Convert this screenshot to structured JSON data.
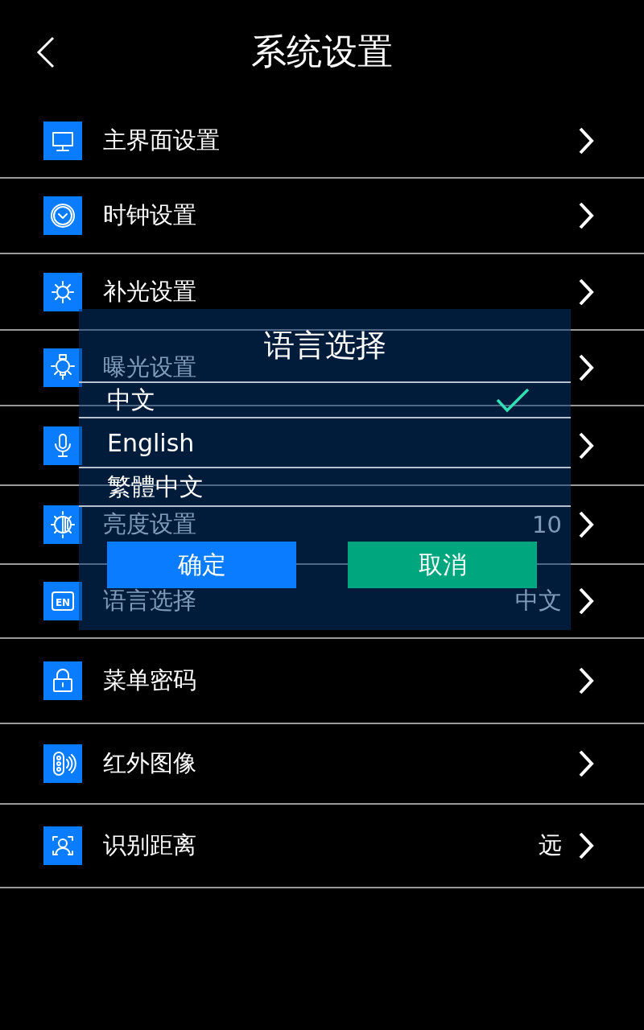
{
  "header": {
    "title": "系统设置"
  },
  "menu": [
    {
      "label": "主界面设置",
      "chevron": true
    },
    {
      "label": "时钟设置",
      "chevron": true
    },
    {
      "label": "补光设置",
      "chevron": true
    },
    {
      "label": "曝光设置",
      "chevron": true
    },
    {
      "chevron": true
    },
    {
      "label": "亮度设置",
      "value": "10",
      "chevron": true
    },
    {
      "label": "语言选择",
      "value": "中文",
      "icon_text": "EN",
      "chevron": true
    },
    {
      "label": "菜单密码",
      "chevron": true
    },
    {
      "label": "红外图像",
      "chevron": true
    },
    {
      "label": "识别距离",
      "value": "远",
      "chevron": true
    }
  ],
  "dialog": {
    "title": "语言选择",
    "options": [
      {
        "label": "中文",
        "selected": true
      },
      {
        "label": "English",
        "selected": false
      },
      {
        "label": "繁體中文",
        "selected": false
      }
    ],
    "buttons": [
      {
        "label": "确定",
        "kind": "primary"
      },
      {
        "label": "取消",
        "kind": "secondary"
      }
    ]
  }
}
